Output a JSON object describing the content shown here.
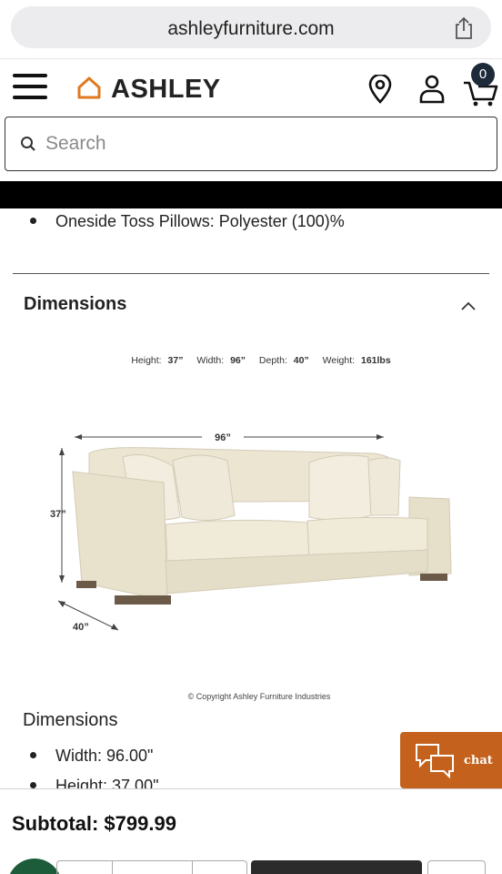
{
  "browser": {
    "url": "ashleyfurniture.com"
  },
  "header": {
    "logo_text": "ASHLEY",
    "cart_count": "0"
  },
  "search": {
    "placeholder": "Search"
  },
  "materials": {
    "items": [
      "Oneside Toss Pillows: Polyester (100)%"
    ]
  },
  "dimensions_section": {
    "title": "Dimensions"
  },
  "diagram": {
    "specs": [
      {
        "label": "Height:",
        "value": "37”"
      },
      {
        "label": "Width:",
        "value": "96”"
      },
      {
        "label": "Depth:",
        "value": "40”"
      },
      {
        "label": "Weight:",
        "value": "161lbs"
      }
    ],
    "width_label": "96”",
    "height_label": "37”",
    "depth_label": "40”",
    "copyright": "© Copyright Ashley Furniture Industries"
  },
  "dimensions_list": {
    "heading": "Dimensions",
    "items": [
      "Width: 96.00\"",
      "Height: 37.00\""
    ]
  },
  "chat": {
    "label": "chat"
  },
  "footer": {
    "subtotal": "Subtotal: $799.99"
  },
  "colors": {
    "chat_orange": "#c4621d",
    "logo_orange": "#e07a22",
    "cart_badge": "#1d2a3a",
    "sofa_fabric": "#ece6d3",
    "fab_green": "#1d5c3a"
  }
}
